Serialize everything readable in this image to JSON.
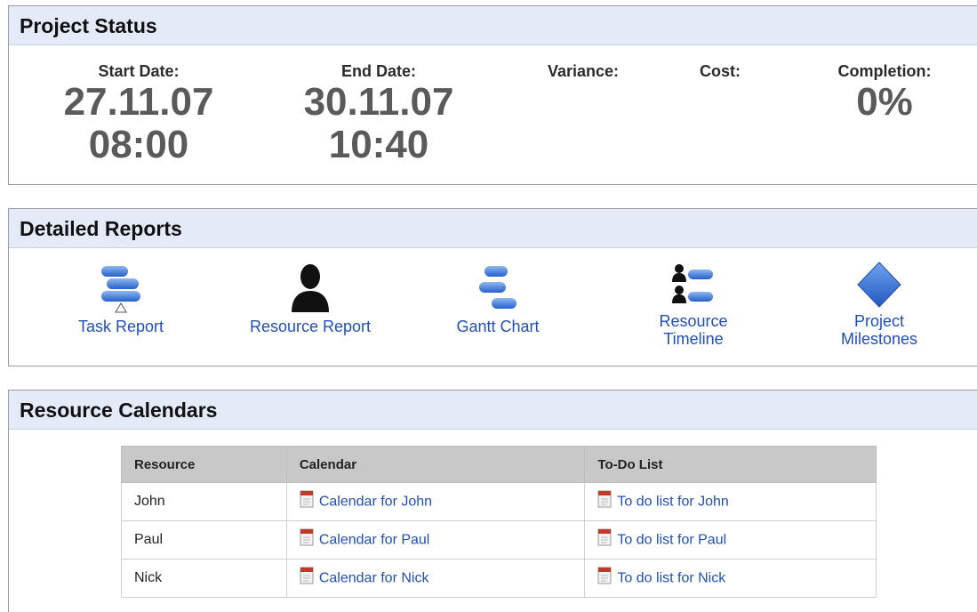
{
  "status": {
    "title": "Project Status",
    "start_label": "Start Date:",
    "start_date": "27.11.07",
    "start_time": "08:00",
    "end_label": "End Date:",
    "end_date": "30.11.07",
    "end_time": "10:40",
    "variance_label": "Variance:",
    "cost_label": "Cost:",
    "completion_label": "Completion:",
    "completion_value": "0%"
  },
  "reports": {
    "title": "Detailed Reports",
    "items": [
      {
        "label": "Task Report",
        "icon": "task-report-icon"
      },
      {
        "label": "Resource Report",
        "icon": "resource-person-icon"
      },
      {
        "label": "Gantt Chart",
        "icon": "gantt-chart-icon"
      },
      {
        "label_line1": "Resource",
        "label_line2": "Timeline",
        "icon": "resource-timeline-icon"
      },
      {
        "label_line1": "Project",
        "label_line2": "Milestones",
        "icon": "milestone-diamond-icon"
      }
    ]
  },
  "calendars": {
    "title": "Resource Calendars",
    "columns": [
      "Resource",
      "Calendar",
      "To-Do List"
    ],
    "rows": [
      {
        "resource": "John",
        "calendar": "Calendar for John",
        "todo": "To do list for John"
      },
      {
        "resource": "Paul",
        "calendar": "Calendar for Paul",
        "todo": "To do list for Paul"
      },
      {
        "resource": "Nick",
        "calendar": "Calendar for Nick",
        "todo": "To do list for Nick"
      }
    ]
  },
  "colors": {
    "header_bg": "#e4eaf8",
    "link": "#1f4fb8",
    "icon_blue": "#2f73d8",
    "stat_value": "#5a5a5a"
  }
}
